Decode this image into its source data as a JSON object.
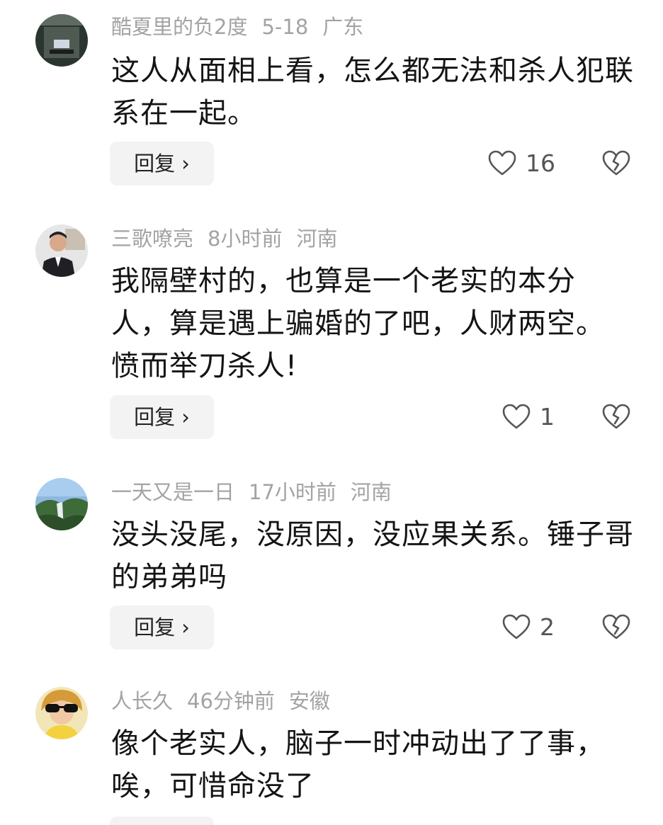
{
  "comments": [
    {
      "username": "酷夏里的负2度",
      "time": "5-18",
      "location": "广东",
      "text": "这人从面相上看，怎么都无法和杀人犯联系在一起。",
      "reply_label": "回复 ›",
      "likes": "16"
    },
    {
      "username": "三歌嘹亮",
      "time": "8小时前",
      "location": "河南",
      "text": "我隔壁村的，也算是一个老实的本分人，算是遇上骗婚的了吧，人财两空。愤而举刀杀人!",
      "reply_label": "回复 ›",
      "likes": "1"
    },
    {
      "username": "一天又是一日",
      "time": "17小时前",
      "location": "河南",
      "text": "没头没尾，没原因，没应果关系。锤子哥的弟弟吗",
      "reply_label": "回复 ›",
      "likes": "2"
    },
    {
      "username": "人长久",
      "time": "46分钟前",
      "location": "安徽",
      "text": "像个老实人，脑子一时冲动出了了事，唉，可惜命没了"
    }
  ],
  "icons": {
    "like": "heart-outline-icon",
    "dislike": "broken-heart-icon"
  },
  "colors": {
    "meta_text": "#a3a3a3",
    "reply_bg": "#f3f3f3"
  }
}
